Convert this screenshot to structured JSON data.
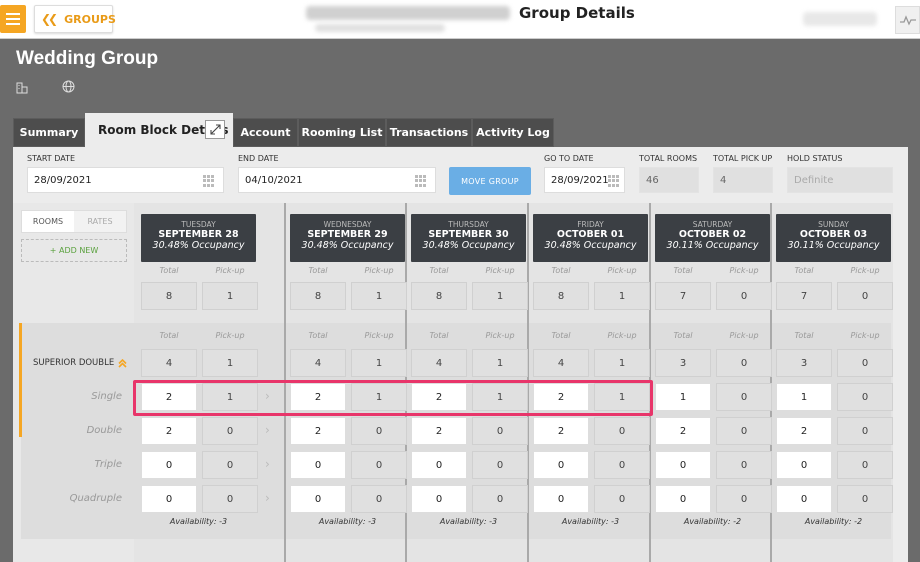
{
  "header": {
    "groups_label": "GROUPS",
    "page_title": "Group Details"
  },
  "group": {
    "name": "Wedding Group"
  },
  "tabs": [
    {
      "label": "Summary"
    },
    {
      "label": "Room Block Details"
    },
    {
      "label": "Account"
    },
    {
      "label": "Rooming List"
    },
    {
      "label": "Transactions"
    },
    {
      "label": "Activity Log"
    }
  ],
  "fields": {
    "start_date_label": "START DATE",
    "start_date": "28/09/2021",
    "end_date_label": "END DATE",
    "end_date": "04/10/2021",
    "move_group": "MOVE GROUP",
    "go_to_date_label": "GO TO DATE",
    "go_to_date": "28/09/2021",
    "total_rooms_label": "TOTAL ROOMS",
    "total_rooms": "46",
    "total_pickup_label": "TOTAL PICK UP",
    "total_pickup": "4",
    "hold_status_label": "HOLD STATUS",
    "hold_status": "Definite"
  },
  "left_panel": {
    "rooms_tab": "ROOMS",
    "rates_tab": "RATES",
    "add_new": "+ ADD NEW",
    "room_type": "SUPERIOR DOUBLE",
    "rows": [
      "Single",
      "Double",
      "Triple",
      "Quadruple"
    ]
  },
  "labels": {
    "total": "Total",
    "pickup": "Pick-up"
  },
  "days": [
    {
      "weekday": "TUESDAY",
      "date": "SEPTEMBER 28",
      "occupancy": "30.48% Occupancy",
      "total": "8",
      "pickup": "1",
      "room_total": "4",
      "room_pickup": "1",
      "single": [
        "2",
        "1"
      ],
      "double": [
        "2",
        "0"
      ],
      "triple": [
        "0",
        "0"
      ],
      "quadruple": [
        "0",
        "0"
      ],
      "availability": "Availability: -3"
    },
    {
      "weekday": "WEDNESDAY",
      "date": "SEPTEMBER 29",
      "occupancy": "30.48% Occupancy",
      "total": "8",
      "pickup": "1",
      "room_total": "4",
      "room_pickup": "1",
      "single": [
        "2",
        "1"
      ],
      "double": [
        "2",
        "0"
      ],
      "triple": [
        "0",
        "0"
      ],
      "quadruple": [
        "0",
        "0"
      ],
      "availability": "Availability: -3"
    },
    {
      "weekday": "THURSDAY",
      "date": "SEPTEMBER 30",
      "occupancy": "30.48% Occupancy",
      "total": "8",
      "pickup": "1",
      "room_total": "4",
      "room_pickup": "1",
      "single": [
        "2",
        "1"
      ],
      "double": [
        "2",
        "0"
      ],
      "triple": [
        "0",
        "0"
      ],
      "quadruple": [
        "0",
        "0"
      ],
      "availability": "Availability: -3"
    },
    {
      "weekday": "FRIDAY",
      "date": "OCTOBER 01",
      "occupancy": "30.48% Occupancy",
      "total": "8",
      "pickup": "1",
      "room_total": "4",
      "room_pickup": "1",
      "single": [
        "2",
        "1"
      ],
      "double": [
        "2",
        "0"
      ],
      "triple": [
        "0",
        "0"
      ],
      "quadruple": [
        "0",
        "0"
      ],
      "availability": "Availability: -3"
    },
    {
      "weekday": "SATURDAY",
      "date": "OCTOBER 02",
      "occupancy": "30.11% Occupancy",
      "total": "7",
      "pickup": "0",
      "room_total": "3",
      "room_pickup": "0",
      "single": [
        "1",
        "0"
      ],
      "double": [
        "2",
        "0"
      ],
      "triple": [
        "0",
        "0"
      ],
      "quadruple": [
        "0",
        "0"
      ],
      "availability": "Availability: -2"
    },
    {
      "weekday": "SUNDAY",
      "date": "OCTOBER 03",
      "occupancy": "30.11% Occupancy",
      "total": "7",
      "pickup": "0",
      "room_total": "3",
      "room_pickup": "0",
      "single": [
        "1",
        "0"
      ],
      "double": [
        "2",
        "0"
      ],
      "triple": [
        "0",
        "0"
      ],
      "quadruple": [
        "0",
        "0"
      ],
      "availability": "Availability: -2"
    }
  ],
  "colors": {
    "accent": "#f5a623",
    "highlight": "#e8356a",
    "button_blue": "#6aaee5"
  }
}
